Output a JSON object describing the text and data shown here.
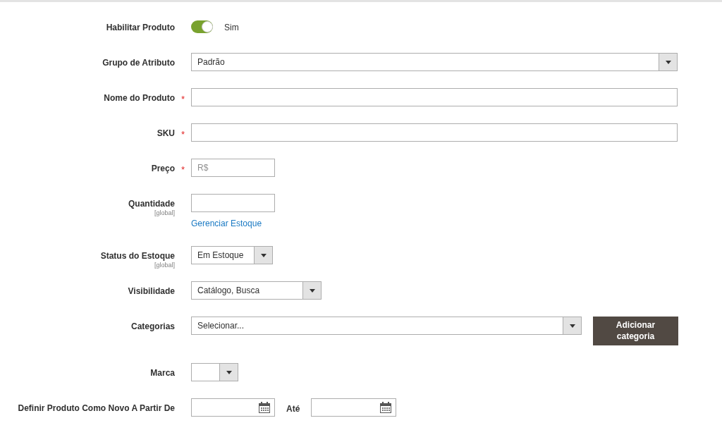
{
  "fields": [
    {
      "kind": "toggle",
      "label": "Habilitar Produto",
      "on": true,
      "value": "Sim"
    },
    {
      "kind": "select",
      "label": "Grupo de Atributo",
      "value": "Padrão"
    },
    {
      "kind": "text",
      "label": "Nome do Produto",
      "required_mark": "*"
    },
    {
      "kind": "text",
      "label": "SKU",
      "required_mark": "*"
    },
    {
      "kind": "text",
      "label": "Preço",
      "required_mark": "*",
      "placeholder": "R$"
    },
    {
      "kind": "text",
      "label": "Quantidade",
      "scope": "[global]",
      "link": "Gerenciar Estoque"
    },
    {
      "kind": "select",
      "label": "Status do Estoque",
      "scope": "[global]",
      "value": "Em Estoque"
    },
    {
      "kind": "select",
      "label": "Visibilidade",
      "value": "Catálogo, Busca"
    },
    {
      "kind": "select",
      "label": "Categorias",
      "value": "Selecionar...",
      "button": "Adicionar categoria"
    },
    {
      "kind": "select",
      "label": "Marca"
    },
    {
      "kind": "daterange",
      "label": "Definir Produto Como Novo A Partir De",
      "to_label": "Até"
    }
  ]
}
